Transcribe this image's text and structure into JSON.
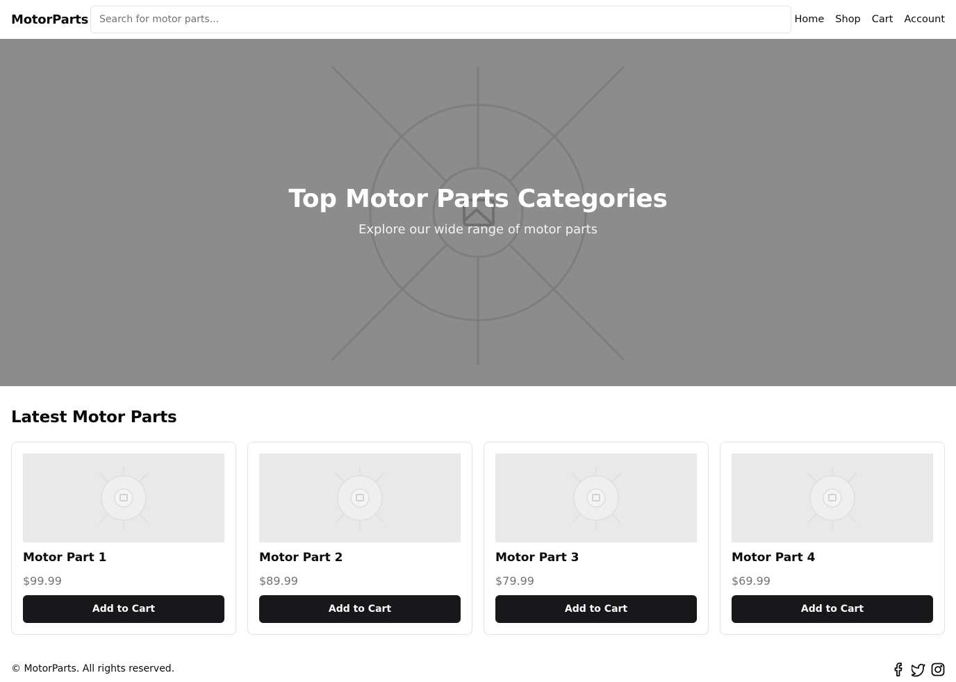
{
  "header": {
    "brand": "MotorParts",
    "search_placeholder": "Search for motor parts...",
    "nav": [
      "Home",
      "Shop",
      "Cart",
      "Account"
    ]
  },
  "hero": {
    "title": "Top Motor Parts Categories",
    "subtitle": "Explore our wide range of motor parts",
    "background_color": "#8c8c8c",
    "image_icon": "image-placeholder-icon"
  },
  "latest": {
    "title": "Latest Motor Parts",
    "products": [
      {
        "name": "Motor Part 1",
        "price": "$99.99",
        "button": "Add to Cart"
      },
      {
        "name": "Motor Part 2",
        "price": "$89.99",
        "button": "Add to Cart"
      },
      {
        "name": "Motor Part 3",
        "price": "$79.99",
        "button": "Add to Cart"
      },
      {
        "name": "Motor Part 4",
        "price": "$69.99",
        "button": "Add to Cart"
      }
    ]
  },
  "footer": {
    "copyright": "© MotorParts. All rights reserved.",
    "social_icons": [
      "facebook-icon",
      "twitter-icon",
      "instagram-icon"
    ]
  },
  "colors": {
    "primary_button": "#18181b",
    "muted_text": "#71717a",
    "border": "#e4e4e7"
  }
}
